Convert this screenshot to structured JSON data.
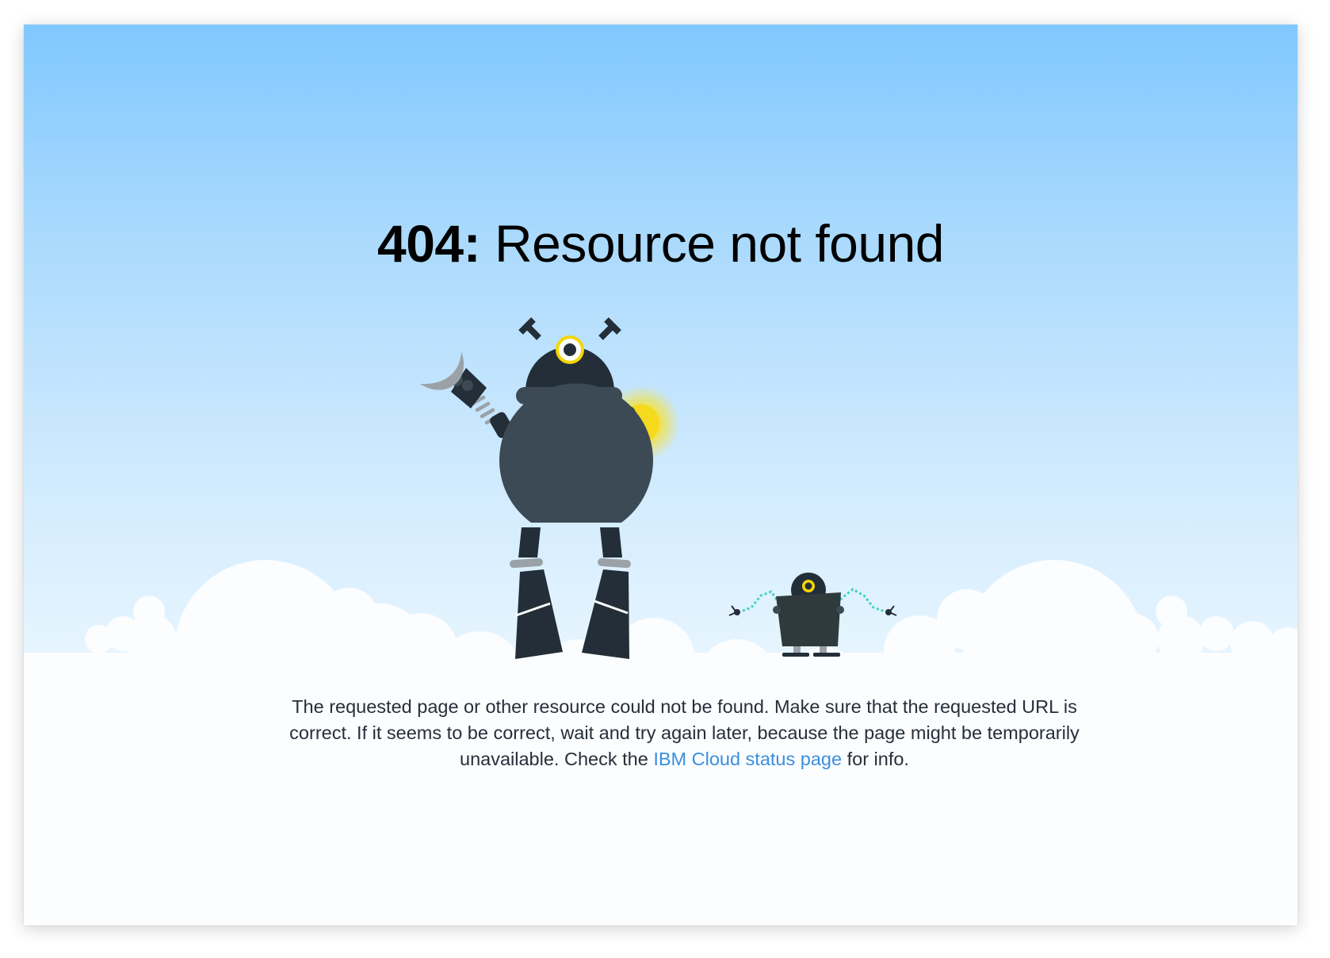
{
  "error": {
    "code": "404:",
    "heading": " Resource not found"
  },
  "message": {
    "text_before": "The requested page or other resource could not be found. Make sure that the requested URL is correct. If it seems to be correct, wait and try again later, because the page might be temporarily unavailable. Check the ",
    "link_label": "IBM Cloud status page",
    "text_after": " for info."
  },
  "colors": {
    "sky_top": "#80c8ff",
    "sky_bottom": "#edf8ff",
    "robot_dark": "#232e38",
    "robot_body": "#3b4a54",
    "robot_grey": "#9aa2a8",
    "eye_yellow": "#f6d600",
    "antenna_teal": "#3fd4c0",
    "link": "#3b8fdf",
    "text": "#262f3a"
  },
  "icons": [
    "big-robot-icon",
    "small-robot-icon",
    "cloud-icon"
  ]
}
